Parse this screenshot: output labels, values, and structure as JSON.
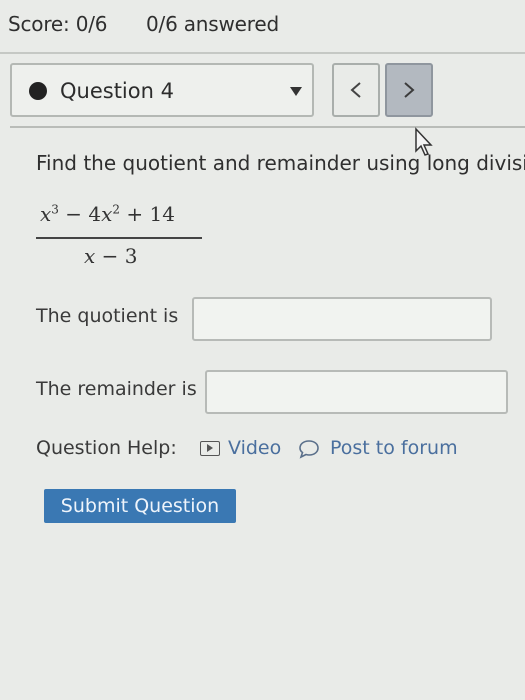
{
  "header": {
    "score": "Score: 0/6",
    "answered": "0/6 answered"
  },
  "question_nav": {
    "current_question": "Question 4"
  },
  "problem": {
    "instruction": "Find the quotient and remainder using long divisi",
    "numerator": {
      "a": "x",
      "a_exp": "3",
      "op1": " − 4",
      "b": "x",
      "b_exp": "2",
      "op2": " + 14"
    },
    "denominator": {
      "var": "x",
      "rest": " − 3"
    }
  },
  "answers": {
    "quotient_label": "The quotient is",
    "quotient_value": "",
    "remainder_label": "The remainder is",
    "remainder_value": ""
  },
  "help": {
    "label": "Question Help:",
    "video": "Video",
    "forum": "Post to forum"
  },
  "submit_label": "Submit Question",
  "colors": {
    "accent": "#3a78b3",
    "link": "#4a6f9e",
    "background": "#e9ebe8"
  }
}
